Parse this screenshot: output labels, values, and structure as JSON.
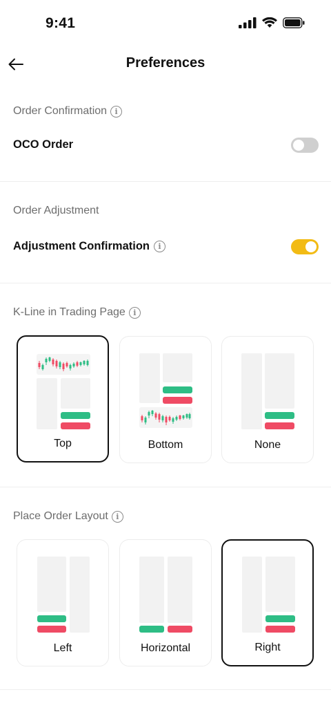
{
  "status": {
    "time": "9:41"
  },
  "nav": {
    "title": "Preferences",
    "back_icon": "arrow-left-icon"
  },
  "sections": {
    "order_confirmation": {
      "title": "Order Confirmation",
      "row_label": "OCO Order",
      "toggle_on": false
    },
    "order_adjustment": {
      "title": "Order Adjustment",
      "row_label": "Adjustment Confirmation",
      "toggle_on": true
    },
    "kline": {
      "title": "K-Line in Trading Page",
      "options": [
        {
          "label": "Top",
          "selected": true
        },
        {
          "label": "Bottom",
          "selected": false
        },
        {
          "label": "None",
          "selected": false
        }
      ]
    },
    "layout": {
      "title": "Place Order Layout",
      "options": [
        {
          "label": "Left",
          "selected": false
        },
        {
          "label": "Horizontal",
          "selected": false
        },
        {
          "label": "Right",
          "selected": true
        }
      ]
    }
  },
  "colors": {
    "toggle_on": "#f2bb15",
    "toggle_off": "#cfcfcf",
    "buy_green": "#2ebd85",
    "sell_red": "#ef4b64",
    "placeholder": "#f2f2f2"
  }
}
